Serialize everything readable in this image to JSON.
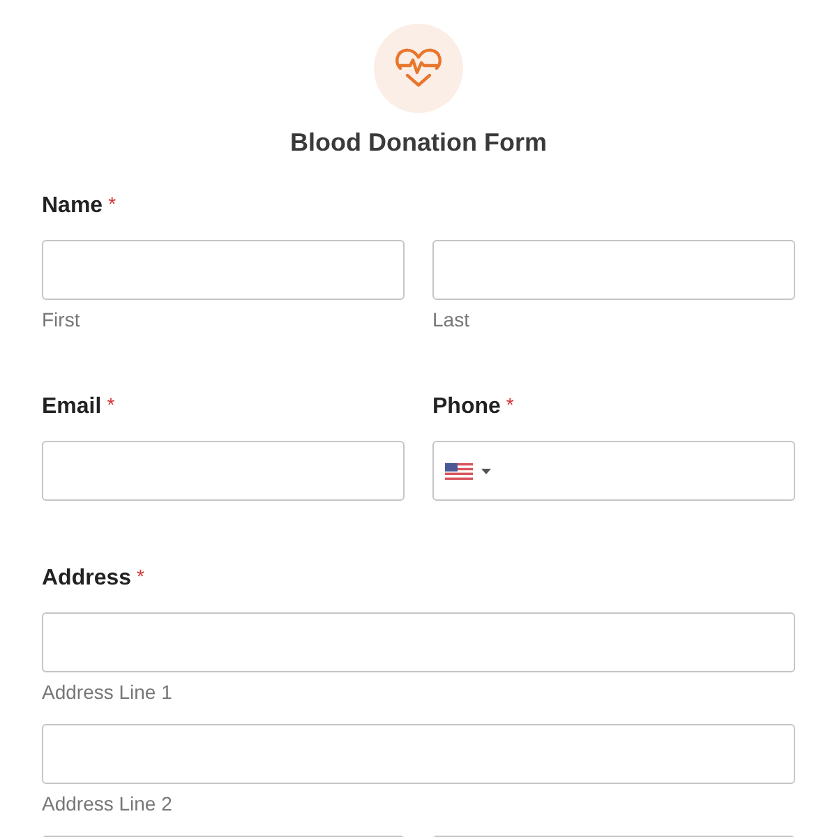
{
  "header": {
    "title": "Blood Donation Form"
  },
  "name": {
    "label": "Name",
    "required_mark": "*",
    "fields": [
      {
        "sublabel": "First"
      },
      {
        "sublabel": "Last"
      }
    ]
  },
  "email": {
    "label": "Email",
    "required_mark": "*"
  },
  "phone": {
    "label": "Phone",
    "required_mark": "*"
  },
  "address": {
    "label": "Address",
    "required_mark": "*",
    "lines": [
      {
        "sublabel": "Address Line 1"
      },
      {
        "sublabel": "Address Line 2"
      }
    ]
  }
}
